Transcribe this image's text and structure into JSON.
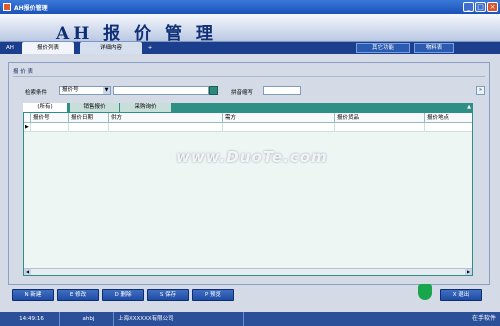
{
  "window": {
    "title": "AH报价管理"
  },
  "banner": {
    "title": "AH 报 价 管 理"
  },
  "top_tabs": [
    {
      "label": "AH"
    },
    {
      "label": "报价列表"
    },
    {
      "label": "详细内容"
    },
    {
      "label": "+"
    }
  ],
  "top_buttons": [
    {
      "label": "其它功能"
    },
    {
      "label": "物料表"
    }
  ],
  "panel": {
    "title": "报 价 表"
  },
  "search": {
    "criteria_label": "检索条件",
    "criteria_value": "报价号",
    "pinyin_label": "拼音缩写"
  },
  "sub_tabs": [
    {
      "label": "(所有)"
    },
    {
      "label": "销售报价"
    },
    {
      "label": "采购询价"
    }
  ],
  "grid": {
    "columns": [
      "报价号",
      "报价日期",
      "供方",
      "需方",
      "报价货品",
      "报价地点"
    ]
  },
  "action_buttons": [
    {
      "key": "N",
      "label": "新建"
    },
    {
      "key": "E",
      "label": "修改"
    },
    {
      "key": "D",
      "label": "删除"
    },
    {
      "key": "S",
      "label": "保存"
    },
    {
      "key": "P",
      "label": "预览"
    }
  ],
  "exit_button": {
    "key": "X",
    "label": "退出"
  },
  "statusbar": {
    "time": "14:49:16",
    "user": "ahbj",
    "company": "上海XXXXXX有限公司",
    "right_text": "在手软件"
  },
  "watermark": "www.DuoTe.com",
  "colors": {
    "accent": "#1b3f8c",
    "teal": "#2e8f85",
    "button": "#1f4ca2"
  }
}
